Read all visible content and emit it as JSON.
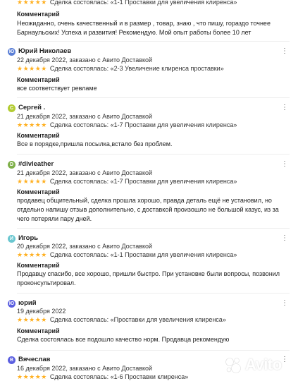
{
  "colors": {
    "star": "#ffb021",
    "avatar_bg": [
      "#5b7fd6",
      "#b3cc33",
      "#7fb04a",
      "#6ac7d0",
      "#5b5fe0",
      "#5b5fe0"
    ]
  },
  "top_partial": {
    "rating_text": "Сделка состоялась: «1-1 Проставки для увеличения клиренса»",
    "stars": "★★★★★",
    "comment_label": "Комментарий",
    "comment": "Неожиданно, очень качественный и в размер , товар, знаю , что пишу, гораздо точнее Барнаульских! Успеха и развития! Рекомендую. Мой опыт работы более 10 лет"
  },
  "reviews": [
    {
      "avatar_letter": "Ю",
      "name": "Юрий Николаев",
      "meta": "22 декабря 2022, заказано с Авито Доставкой",
      "stars": "★★★★★",
      "rating_text": "Сделка состоялась: «2-3 Увеличение клиренса проставки»",
      "comment_label": "Комментарий",
      "comment": "все соответствует ревламе"
    },
    {
      "avatar_letter": "С",
      "name": "Сергей .",
      "meta": "21 декабря 2022, заказано с Авито Доставкой",
      "stars": "★★★★★",
      "rating_text": "Сделка состоялась: «1-7 Проставки для увеличения клиренса»",
      "comment_label": "Комментарий",
      "comment": "Все в порядке,пришла посылка,встало без проблем."
    },
    {
      "avatar_letter": "D",
      "name": "#divleather",
      "meta": "21 декабря 2022, заказано с Авито Доставкой",
      "stars": "★★★★★",
      "rating_text": "Сделка состоялась: «1-7 Проставки для увеличения клиренса»",
      "comment_label": "Комментарий",
      "comment": "продавец общительный, сделка прошла хорошо, правда деталь ещё не установил, но отдельно напишу отзыв дополнительно, с доставкой произошло не большой казус, из за чего потеряли пару дней."
    },
    {
      "avatar_letter": "И",
      "name": "Игорь",
      "meta": "20 декабря 2022, заказано с Авито Доставкой",
      "stars": "★★★★★",
      "rating_text": "Сделка состоялась: «1-1 Проставки для увеличения клиренса»",
      "comment_label": "Комментарий",
      "comment": "Продавцу спасибо, все хорошо, пришли быстро. При установке были вопросы, позвонил проконсультировал."
    },
    {
      "avatar_letter": "Ю",
      "name": "юрий",
      "meta": "19 декабря 2022",
      "stars": "★★★★★",
      "rating_text": "Сделка состоялась: «Проставки для увеличения клиренса»",
      "comment_label": "Комментарий",
      "comment": "Сделка состоялась все подошло качество норм. Продавца рекомендую"
    },
    {
      "avatar_letter": "В",
      "name": "Вячеслав",
      "meta": "16 декабря 2022, заказано с Авито Доставкой",
      "stars": "★★★★★",
      "rating_text": "Сделка состоялась: «1-6 Проставки клиренса»",
      "comment_label": "",
      "comment": ""
    }
  ],
  "more_icon": "⋮",
  "watermark": "Avito"
}
